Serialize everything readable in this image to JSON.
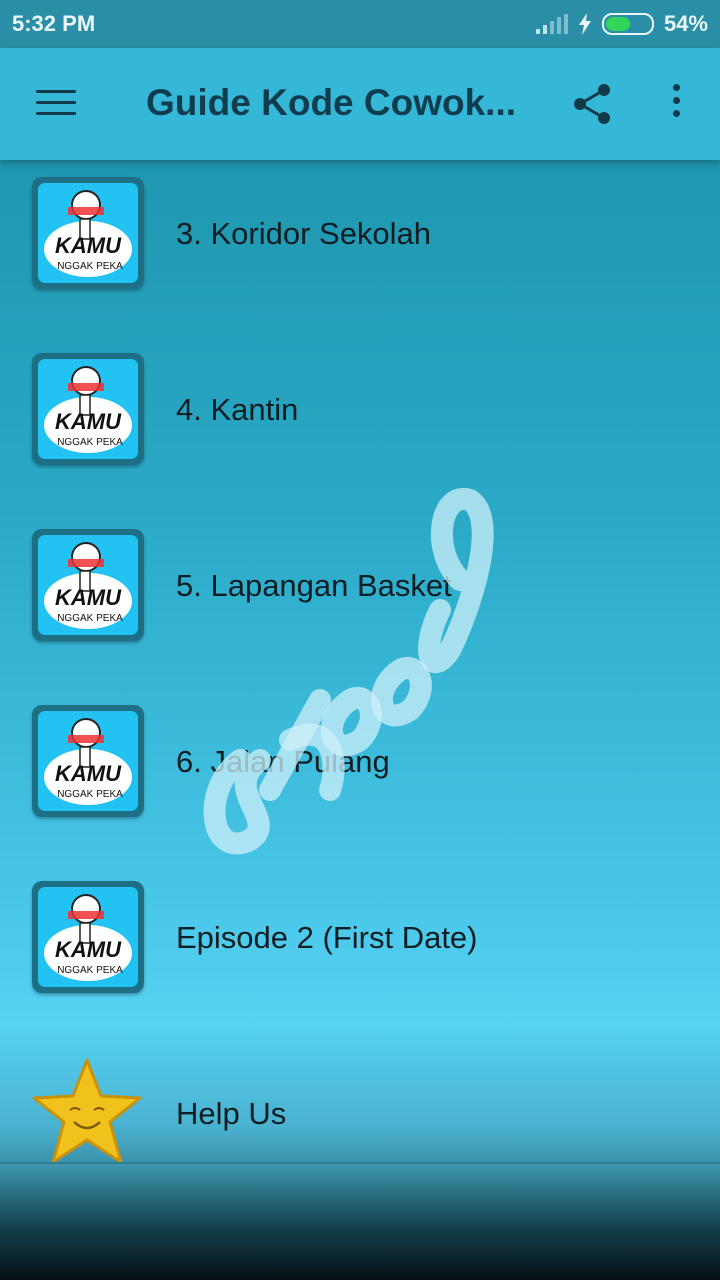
{
  "status": {
    "time": "5:32 PM",
    "battery": "54%",
    "battery_level": 0.54
  },
  "app_bar": {
    "title": "Guide Kode Cowok...",
    "menu_icon": "hamburger-menu-icon",
    "share_icon": "share-icon",
    "more_icon": "more-vert-icon"
  },
  "thumbnail": {
    "main_text": "KAMU",
    "sub_text": "NGGAK PEKA"
  },
  "items": [
    {
      "label": "3. Koridor Sekolah"
    },
    {
      "label": "4. Kantin"
    },
    {
      "label": "5. Lapangan Basket"
    },
    {
      "label": "6. Jalan Pulang"
    },
    {
      "label": "Episode 2 (First Date)"
    },
    {
      "label": "Help Us"
    }
  ],
  "watermark": "styapp"
}
